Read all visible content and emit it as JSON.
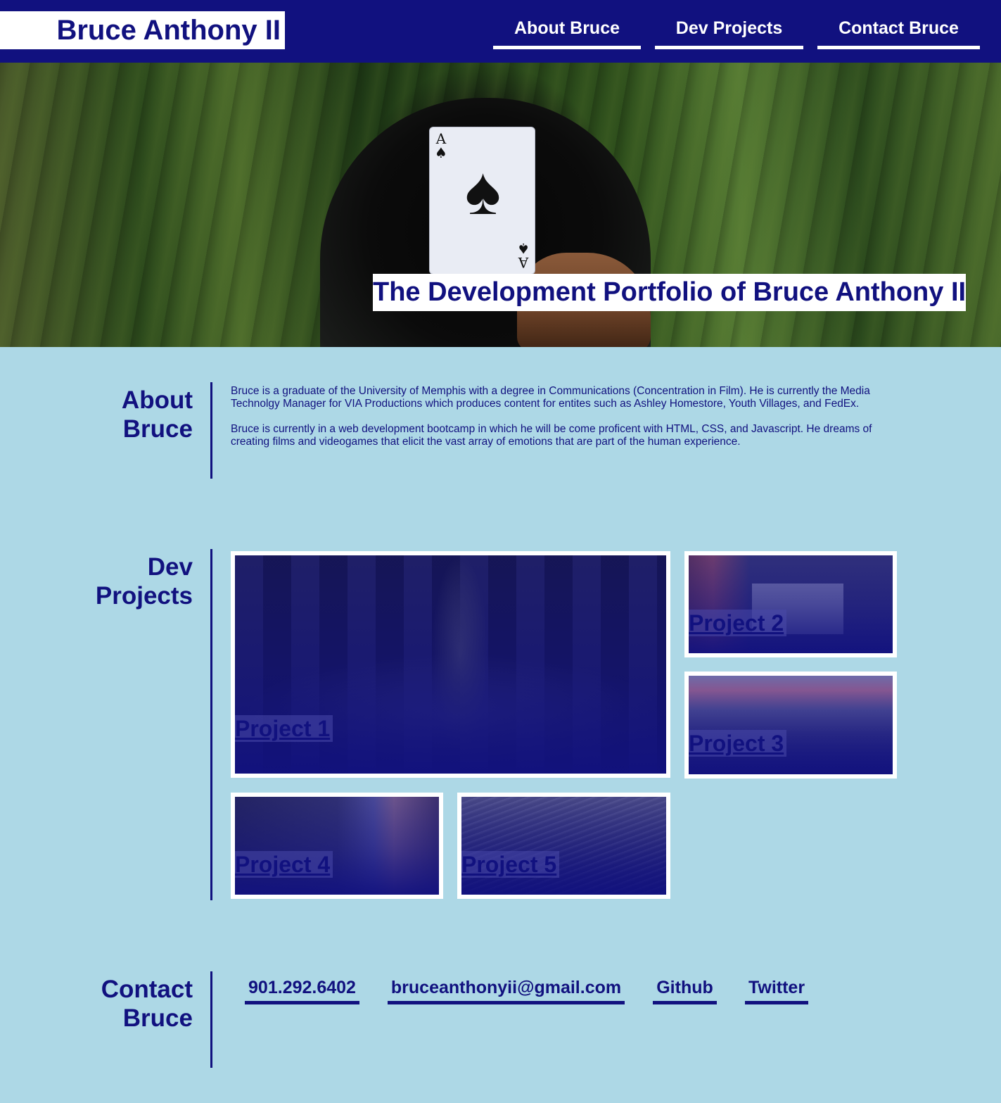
{
  "header": {
    "brand": "Bruce Anthony II",
    "nav": [
      {
        "label": "About Bruce"
      },
      {
        "label": "Dev Projects"
      },
      {
        "label": "Contact Bruce"
      }
    ],
    "colors": {
      "background": "#11117f",
      "text": "#ffffff"
    }
  },
  "hero": {
    "title": "The Development Portfolio of Bruce Anthony II",
    "card": {
      "rank": "A",
      "suit": "♠"
    }
  },
  "about": {
    "title_line1": "About",
    "title_line2": "Bruce",
    "paragraphs": [
      "Bruce is a graduate of the University of Memphis with a degree in Communications (Concentration in Film). He is currently the Media Technolgy Manager for VIA Productions which produces content for entites such as Ashley Homestore, Youth Villages, and FedEx.",
      "Bruce is currently in a web development bootcamp in which he will be come proficent with HTML, CSS, and Javascript. He dreams of creating films and videogames that elicit the vast array of emotions that are part of the human experience."
    ]
  },
  "projects": {
    "title_line1": "Dev",
    "title_line2": "Projects",
    "items": [
      {
        "label": "Project 1"
      },
      {
        "label": "Project 2"
      },
      {
        "label": "Project 3"
      },
      {
        "label": "Project 4"
      },
      {
        "label": "Project 5"
      }
    ]
  },
  "contact": {
    "title_line1": "Contact",
    "title_line2": "Bruce",
    "links": [
      {
        "label": "901.292.6402"
      },
      {
        "label": "bruceanthonyii@gmail.com"
      },
      {
        "label": "Github"
      },
      {
        "label": "Twitter"
      }
    ]
  },
  "colors": {
    "primary": "#11117f",
    "page_background": "#add8e6",
    "white": "#ffffff"
  }
}
